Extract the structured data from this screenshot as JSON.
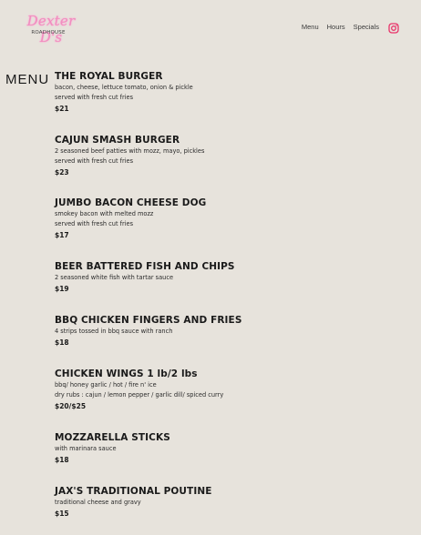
{
  "header": {
    "logo": {
      "script": "Dexter D's",
      "sub": "ROADHOUSE"
    },
    "nav": [
      "Menu",
      "Hours",
      "Specials"
    ],
    "icons": {
      "instagram": "instagram-icon"
    },
    "colors": {
      "logo_pink": "#f08fc0",
      "instagram": "#e8346a"
    }
  },
  "menu_title": "MENU",
  "items": [
    {
      "name": "THE ROYAL BURGER",
      "desc": [
        "bacon, cheese, lettuce tomato, onion & pickle",
        "served with fresh cut fries"
      ],
      "price": "$21"
    },
    {
      "name": "CAJUN SMASH BURGER",
      "desc": [
        "2 seasoned beef patties with mozz, mayo, pickles",
        "served with fresh cut fries"
      ],
      "price": "$23"
    },
    {
      "name": "JUMBO BACON CHEESE DOG",
      "desc": [
        "smokey bacon with melted mozz",
        "served with fresh cut fries"
      ],
      "price": "$17"
    },
    {
      "name": "BEER BATTERED FISH AND CHIPS",
      "desc": [
        "2 seasoned white fish with tartar sauce"
      ],
      "price": "$19"
    },
    {
      "name": "BBQ CHICKEN FINGERS AND FRIES",
      "desc": [
        "4 strips tossed in bbq sauce with ranch"
      ],
      "price": "$18"
    },
    {
      "name": "CHICKEN WINGS 1 lb/2 lbs",
      "desc": [
        "bbq/ honey garlic / hot / fire n' ice",
        "dry rubs : cajun / lemon pepper / garlic dill/ spiced curry"
      ],
      "price": "$20/$25"
    },
    {
      "name": "MOZZARELLA STICKS",
      "desc": [
        "with marinara sauce"
      ],
      "price": "$18"
    },
    {
      "name": "JAX'S TRADITIONAL POUTINE",
      "desc": [
        "traditional cheese and gravy"
      ],
      "price": "$15"
    }
  ]
}
